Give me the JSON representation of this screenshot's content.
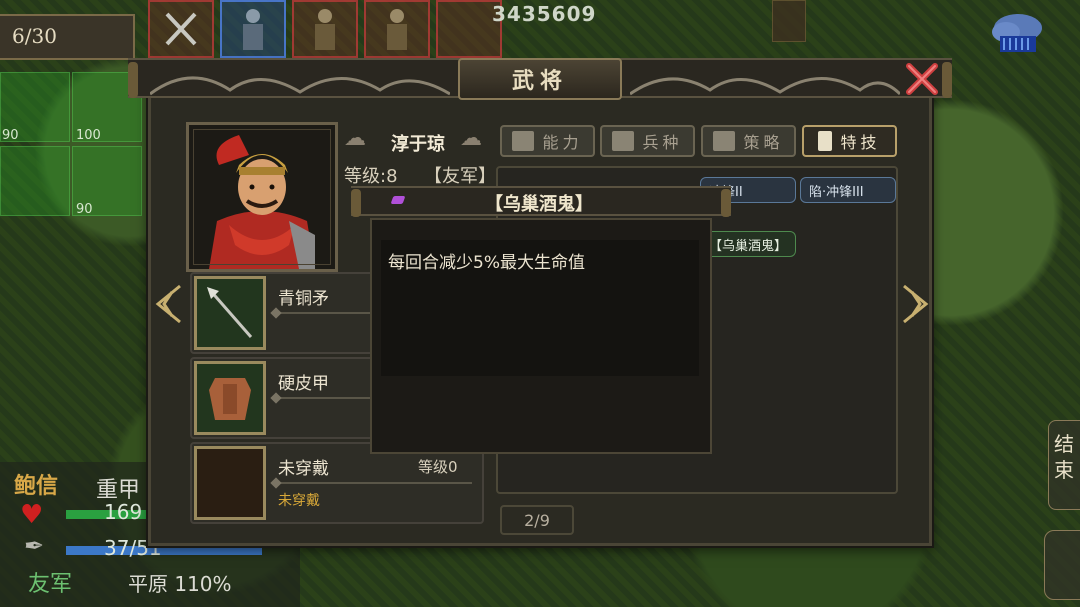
{
  "hud": {
    "turn_counter": "6/30",
    "score": "3435609",
    "tiles": [
      "90",
      "100",
      "90"
    ]
  },
  "unit_status": {
    "name": "鲍信",
    "unit_type": "重甲",
    "hp": "169",
    "mp": "37/51",
    "side": "友军",
    "terrain": "平原 110%"
  },
  "end_turn_label": "结束",
  "dialog": {
    "title": "武将",
    "hero": {
      "name": "淳于琼",
      "level": "等级:8",
      "side": "【友军】"
    },
    "tabs": [
      {
        "label": "能力",
        "active": false,
        "icon": "book-icon"
      },
      {
        "label": "兵种",
        "active": false,
        "icon": "soldier-icon"
      },
      {
        "label": "策略",
        "active": false,
        "icon": "strategy-icon"
      },
      {
        "label": "特技",
        "active": true,
        "icon": "scroll-icon"
      }
    ],
    "skill_chips": [
      "冲锋II",
      "陷·冲锋III",
      "【乌巢酒鬼】"
    ],
    "equipment": [
      {
        "name": "青铜矛",
        "icon": "spear-icon"
      },
      {
        "name": "硬皮甲",
        "icon": "armor-icon"
      },
      {
        "name": "未穿戴",
        "level": "等级0",
        "sub": "未穿戴",
        "icon": "empty-slot"
      }
    ],
    "page_indicator": "2/9"
  },
  "tooltip": {
    "title": "【乌巢酒鬼】",
    "description": "每回合减少5%最大生命值"
  },
  "colors": {
    "panel": "#2b2a22",
    "accent_gold": "#b8a06a",
    "ally_green": "#6cc070",
    "hp_red": "#d02020"
  }
}
